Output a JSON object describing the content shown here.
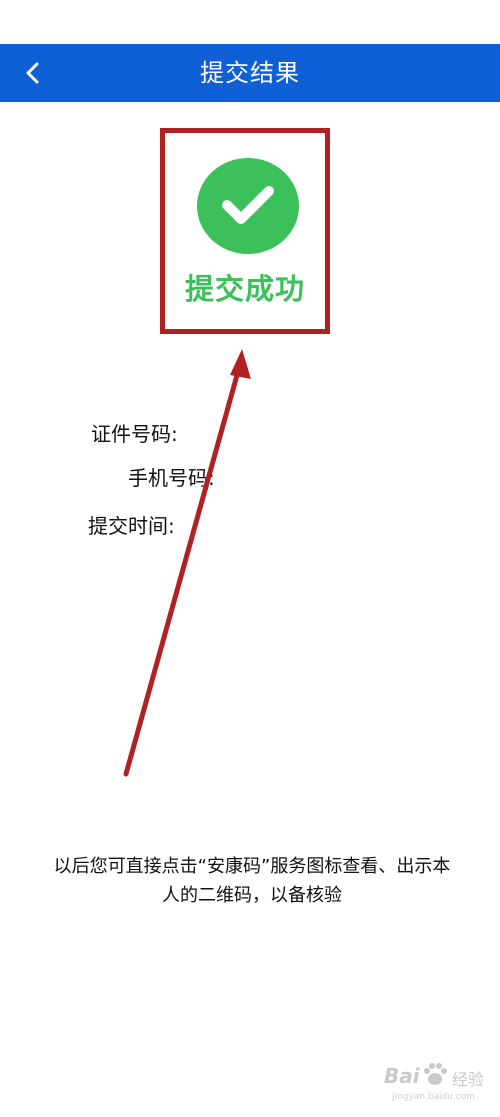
{
  "header": {
    "title": "提交结果",
    "back_icon": "chevron-left-icon",
    "background_color": "#0f5fd6"
  },
  "result": {
    "status_text": "提交成功",
    "icon": "check-circle-icon",
    "accent_color": "#3cc05a"
  },
  "info": {
    "id_label": "证件号码:",
    "phone_label": "手机号码:",
    "time_label": "提交时间:"
  },
  "footer": {
    "note": "以后您可直接点击“安康码”服务图标查看、出示本人的二维码，以备核验"
  },
  "annotation": {
    "highlight_color": "#b02222"
  },
  "watermark": {
    "brand": "Bai",
    "suffix": "经验",
    "url": "jingyan.baidu.com"
  }
}
